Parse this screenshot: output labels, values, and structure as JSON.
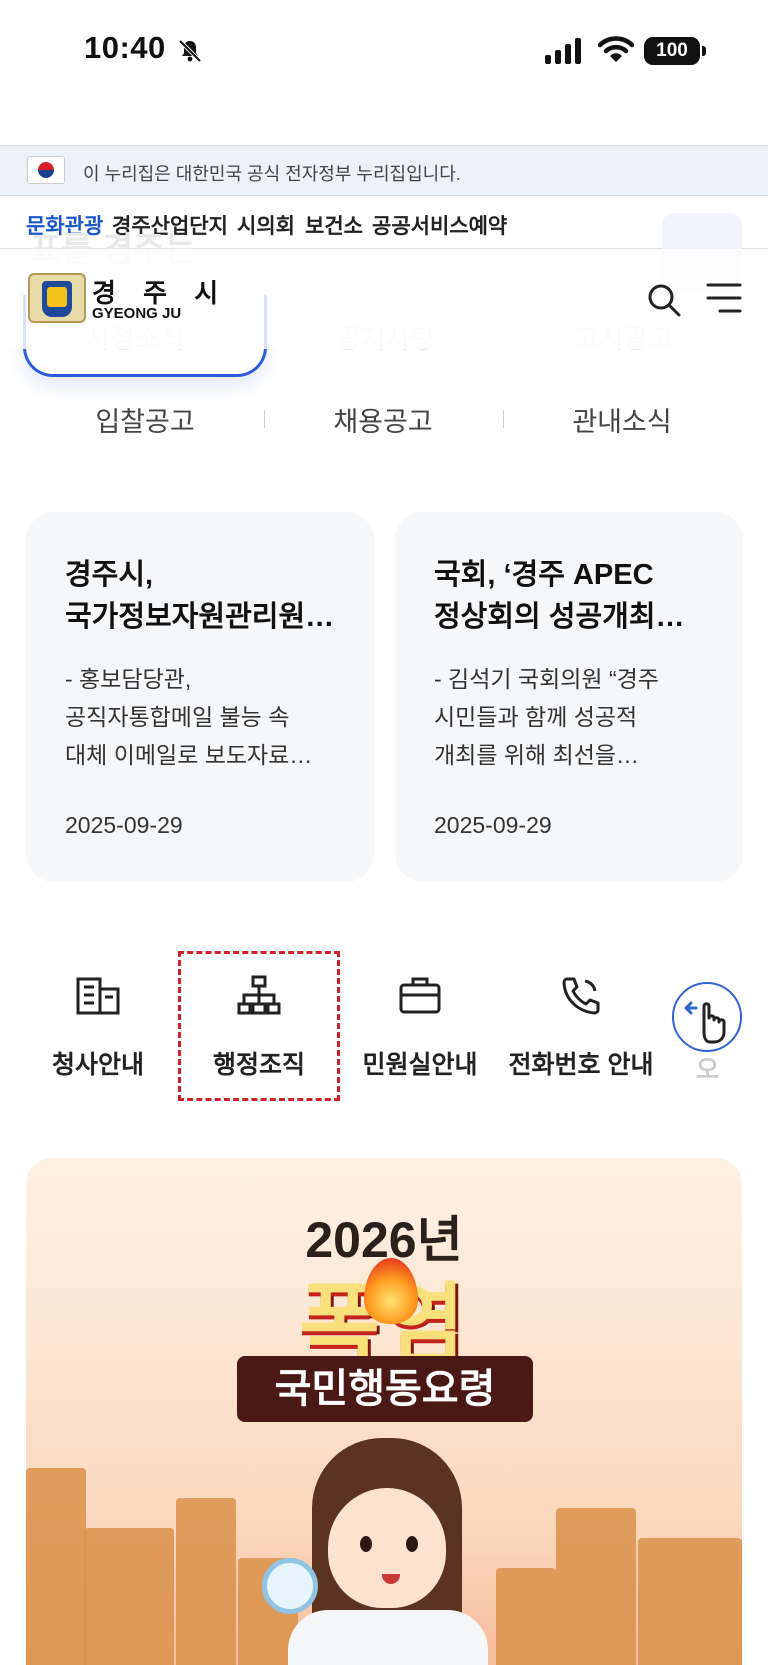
{
  "status_bar": {
    "time": "10:40",
    "battery": "100"
  },
  "gov_banner": {
    "text": "이 누리집은 대한민국 공식 전자정부 누리집입니다."
  },
  "quick_links": [
    "문화관광",
    "경주산업단지",
    "시의회",
    "보건소",
    "공공서비스예약"
  ],
  "quick_links_active_color": "#1a56c8",
  "ghost": {
    "title": "표를 경주는"
  },
  "header": {
    "logo_ko": "경 주 시",
    "logo_en": "GYEONG JU"
  },
  "notice_tabs": {
    "row1": [
      "시정소식",
      "공지사항",
      "고시공고"
    ],
    "row2": [
      "입찰공고",
      "채용공고",
      "관내소식"
    ]
  },
  "news": [
    {
      "title_lines": [
        "경주시,",
        "국가정보자원관리원…"
      ],
      "desc_lines": [
        "- 홍보담당관,",
        "공직자통합메일 불능 속",
        "대체 이메일로 보도자료…"
      ],
      "date": "2025-09-29"
    },
    {
      "title_lines": [
        "국회, ‘경주 APEC",
        "정상회의 성공개최…"
      ],
      "desc_lines": [
        "- 김석기 국회의원 “경주",
        "시민들과 함께 성공적",
        "개최를 위해 최선을…"
      ],
      "date": "2025-09-29"
    }
  ],
  "quick_menu": [
    {
      "label": "청사안내",
      "icon": "building-icon"
    },
    {
      "label": "행정조직",
      "icon": "org-chart-icon"
    },
    {
      "label": "민원실안내",
      "icon": "briefcase-icon"
    },
    {
      "label": "전화번호 안내",
      "icon": "phone-icon"
    },
    {
      "label": "오",
      "icon": ""
    }
  ],
  "banner": {
    "year": "2026년",
    "heat": "폭염",
    "subtitle": "국민행동요령"
  },
  "accent_color": "#2b5bd7",
  "highlight_color": "#d0202a"
}
